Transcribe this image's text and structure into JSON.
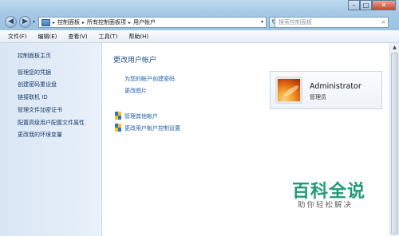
{
  "titlebar": {
    "breadcrumbs": [
      "控制面板",
      "所有控制面板项",
      "用户帐户"
    ],
    "search_placeholder": "搜索控制面板"
  },
  "menu": [
    "文件(F)",
    "编辑(E)",
    "查看(V)",
    "工具(T)",
    "帮助(H)"
  ],
  "sidebar": {
    "items": [
      "控制面板主页",
      "管理您的凭据",
      "创建密码重设盘",
      "链接联机 ID",
      "管理文件加密证书",
      "配置高级用户配置文件属性",
      "更改我的环境变量"
    ]
  },
  "main": {
    "title": "更改用户帐户",
    "links": [
      "为您的帐户创建密码",
      "更改图片"
    ],
    "shield_links": [
      "管理其他帐户",
      "更改用户帐户控制设置"
    ]
  },
  "user": {
    "name": "Administrator",
    "role": "管理员"
  },
  "watermark": {
    "logo": "百科全说",
    "subtitle": "助你轻松解决"
  },
  "colors": {
    "link": "#1e5fa8",
    "title": "#1f4f8b",
    "watermark": "#1f9a76"
  }
}
